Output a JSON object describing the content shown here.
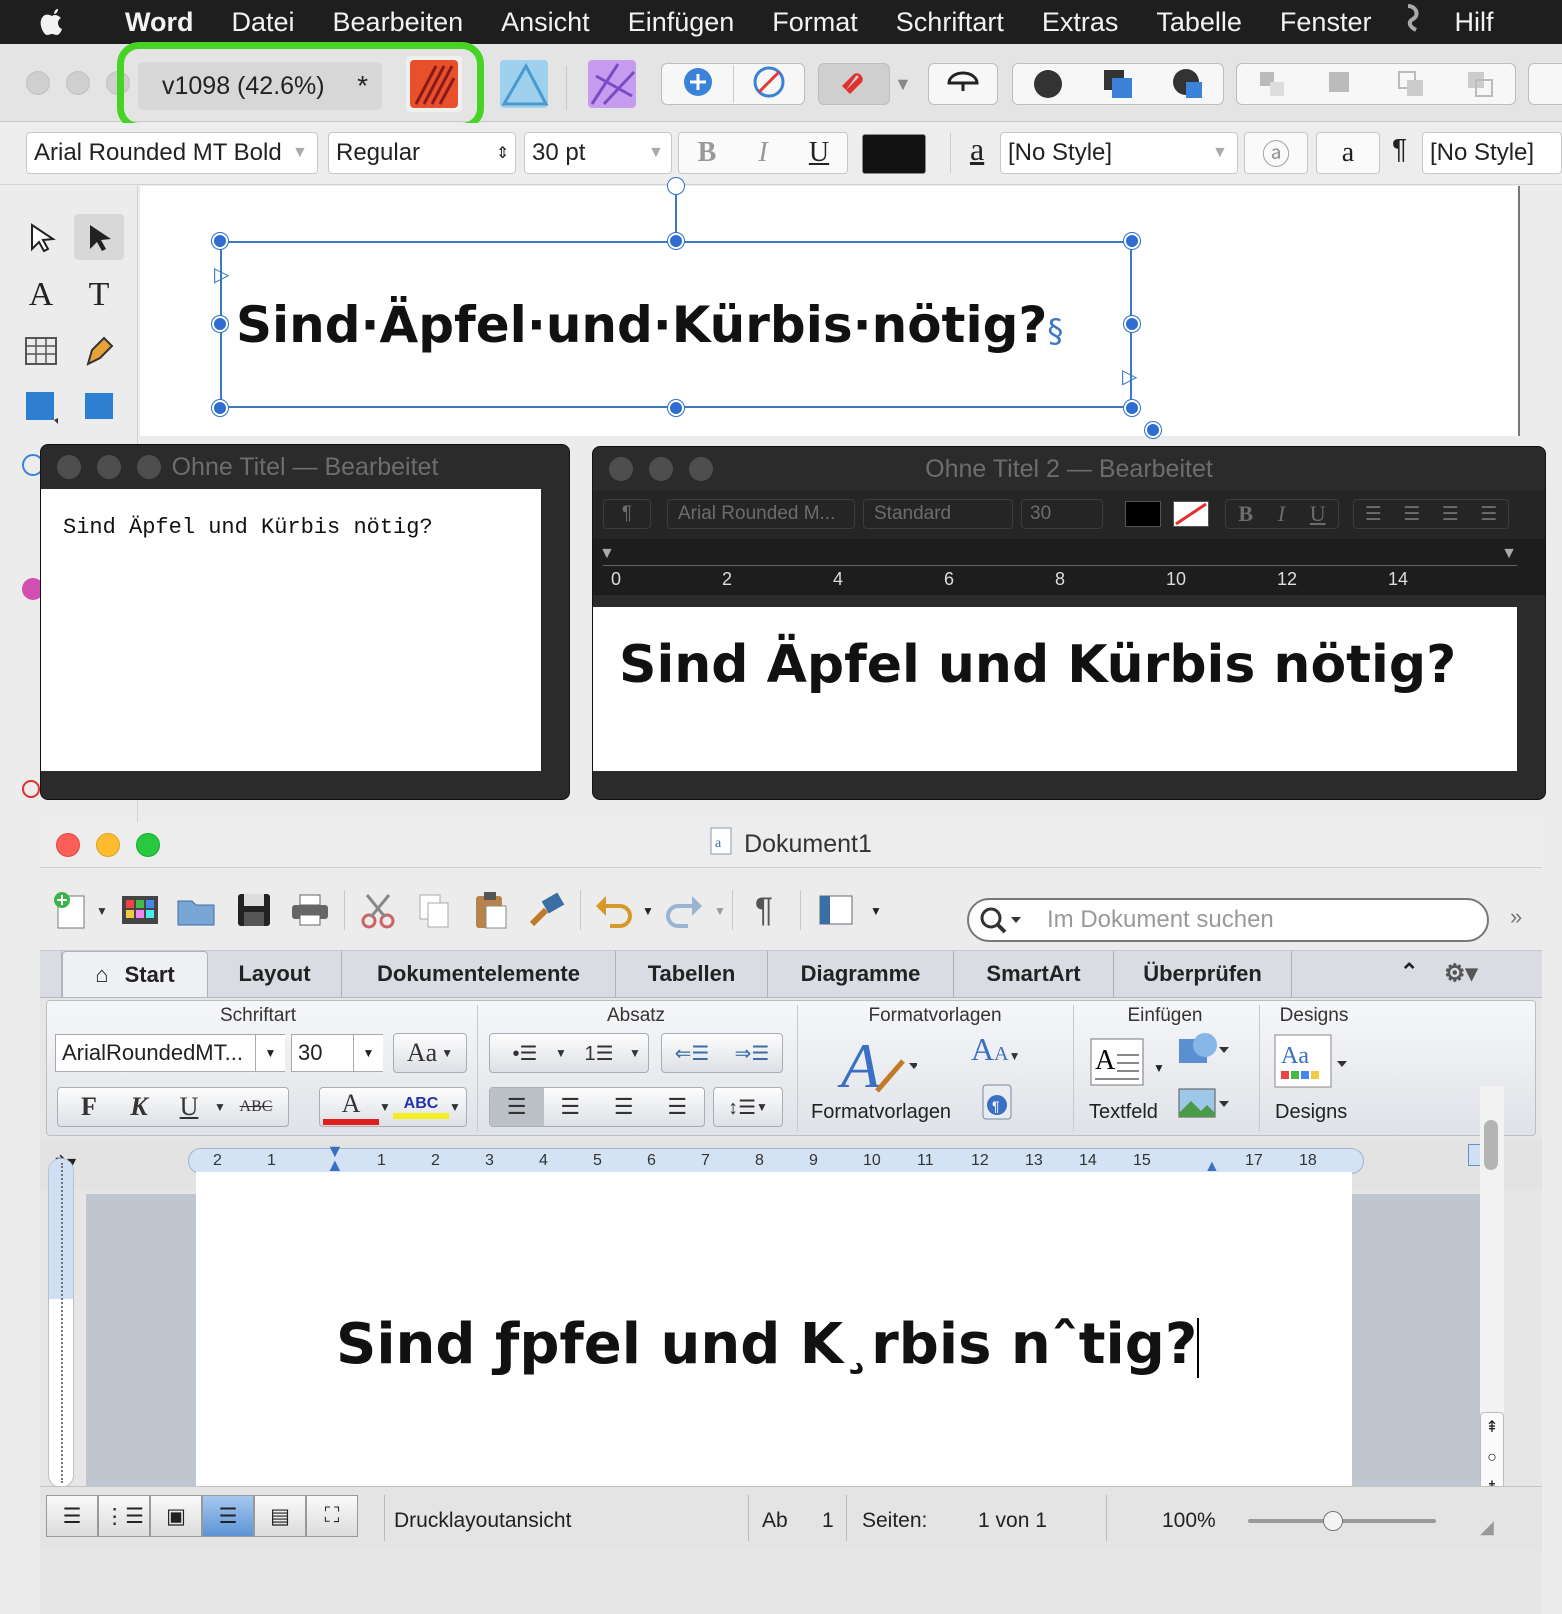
{
  "menubar": {
    "app_name": "Word",
    "items": [
      "Datei",
      "Bearbeiten",
      "Ansicht",
      "Einfügen",
      "Format",
      "Schriftart",
      "Extras",
      "Tabelle",
      "Fenster"
    ],
    "help_label": "Hilf"
  },
  "affinity": {
    "doc_tab": {
      "label": "v1098  (42.6%)",
      "modified_mark": "*"
    },
    "highlight_color": "#46d323",
    "context": {
      "font": "Arial Rounded MT Bold",
      "style": "Regular",
      "size": "30 pt",
      "bold": "B",
      "italic": "I",
      "underline": "U",
      "char_style_glyph": "a",
      "char_style": "[No Style]",
      "para_glyph": "¶",
      "para_style": "[No Style]"
    },
    "frame_text": "Sind·Äpfel·und·Kürbis·nötig?",
    "frame_end_mark": "§",
    "selection_color": "#2f6dd3"
  },
  "textedit_window": {
    "title": "Ohne Titel — Bearbeitet",
    "content": "Sind Äpfel und Kürbis nötig?"
  },
  "textedit2_window": {
    "title": "Ohne Titel 2 — Bearbeitet",
    "toolbar": {
      "para": "¶",
      "font": "Arial Rounded M...",
      "style": "Standard",
      "size": "30",
      "bold": "B",
      "italic": "I",
      "underline": "U"
    },
    "ruler_ticks": [
      "0",
      "2",
      "4",
      "6",
      "8",
      "10",
      "12",
      "14"
    ],
    "content": "Sind Äpfel und Kürbis nötig?"
  },
  "word_window": {
    "title": "Dokument1",
    "search_placeholder": "Im Dokument suchen",
    "tabs": [
      "Start",
      "Layout",
      "Dokumentelemente",
      "Tabellen",
      "Diagramme",
      "SmartArt",
      "Überprüfen"
    ],
    "ribbon": {
      "groups": {
        "font": "Schriftart",
        "paragraph": "Absatz",
        "styles": "Formatvorlagen",
        "insert": "Einfügen",
        "designs": "Designs"
      },
      "font_name": "ArialRoundedMT...",
      "font_size": "30",
      "bold": "F",
      "italic": "K",
      "underline": "U",
      "strike": "ABC",
      "font_color_glyph": "A",
      "highlight_glyph": "ABC",
      "grow_glyph": "Aa",
      "styles_label": "Formatvorlagen",
      "textbox_label": "Textfeld",
      "designs_label": "Designs",
      "designs_glyph": "Aa"
    },
    "ruler_ticks": [
      "2",
      "1",
      "1",
      "1",
      "2",
      "3",
      "4",
      "5",
      "6",
      "7",
      "8",
      "9",
      "10",
      "11",
      "12",
      "13",
      "14",
      "15",
      "17",
      "18"
    ],
    "document_text": "Sind ƒpfel und K¸rbis nˆtig?",
    "status": {
      "view_name": "Drucklayoutansicht",
      "section_label": "Ab",
      "section_value": "1",
      "pages_label": "Seiten:",
      "pages_value": "1 von 1",
      "zoom": "100%",
      "zoom_level": 0.45
    }
  }
}
